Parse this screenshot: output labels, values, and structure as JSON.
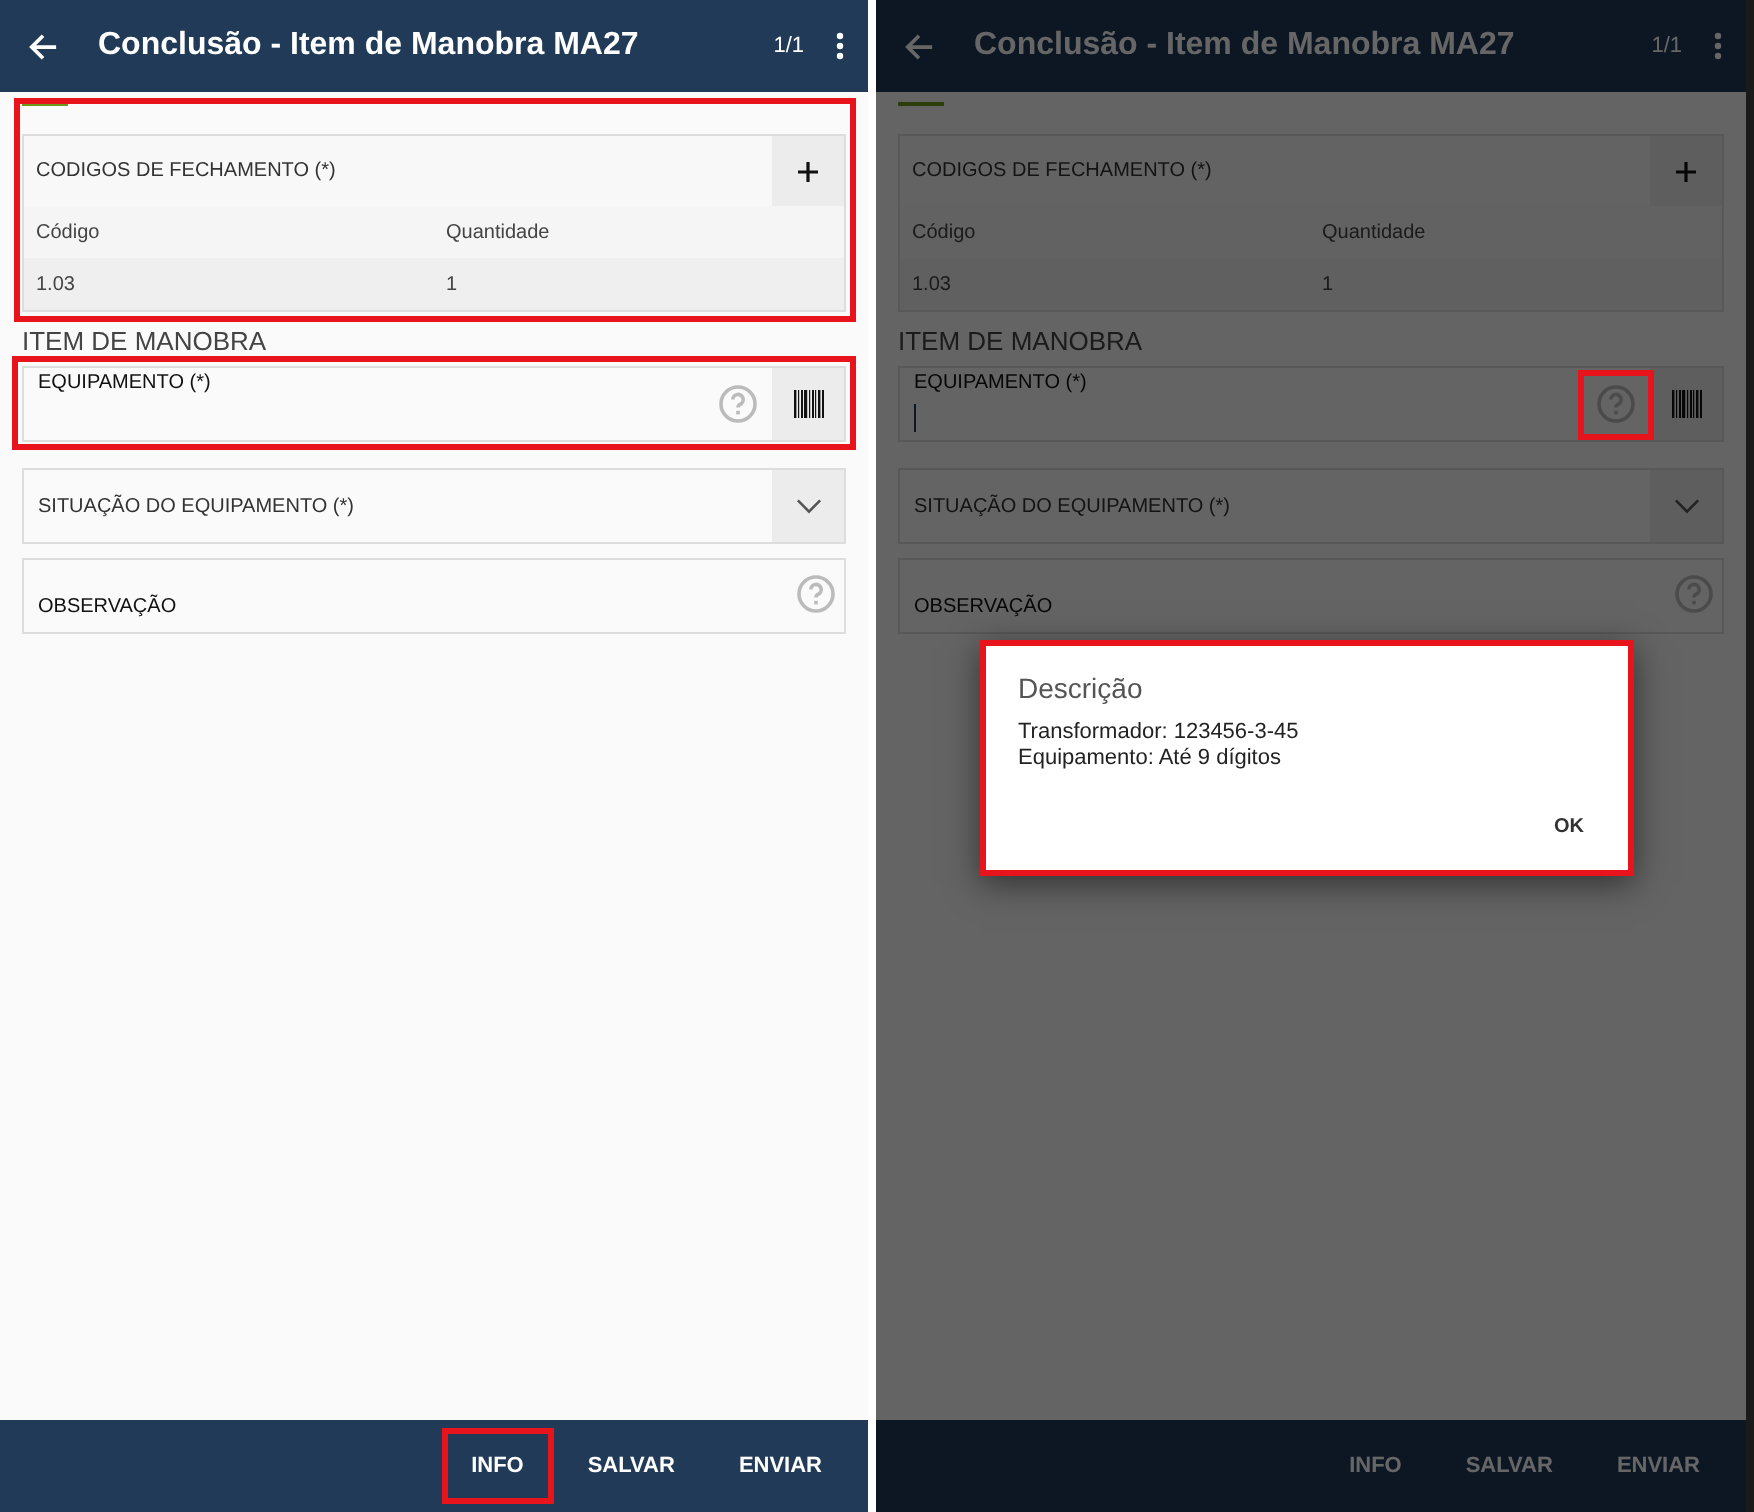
{
  "screens": [
    {
      "dimmed": false,
      "app_bar": {
        "title": "Conclusão - Item de Manobra MA27",
        "page": "1/1"
      },
      "codes_card": {
        "title": "CODIGOS DE FECHAMENTO (*)",
        "highlighted": true,
        "columns": [
          "Código",
          "Quantidade"
        ],
        "rows": [
          [
            "1.03",
            "1"
          ]
        ]
      },
      "section_title": "ITEM DE MANOBRA",
      "equipment_field": {
        "label": "EQUIPAMENTO (*)",
        "highlighted": true,
        "focused": false,
        "help_highlighted": false
      },
      "situation_select": {
        "label": "SITUAÇÃO DO EQUIPAMENTO (*)"
      },
      "observation_field": {
        "label": "OBSERVAÇÃO"
      },
      "actions": [
        {
          "label": "INFO",
          "highlighted": true
        },
        {
          "label": "SALVAR",
          "highlighted": false
        },
        {
          "label": "ENVIAR",
          "highlighted": false
        }
      ]
    },
    {
      "dimmed": true,
      "app_bar": {
        "title": "Conclusão - Item de Manobra MA27",
        "page": "1/1"
      },
      "codes_card": {
        "title": "CODIGOS DE FECHAMENTO (*)",
        "highlighted": false,
        "columns": [
          "Código",
          "Quantidade"
        ],
        "rows": [
          [
            "1.03",
            "1"
          ]
        ]
      },
      "section_title": "ITEM DE MANOBRA",
      "equipment_field": {
        "label": "EQUIPAMENTO (*)",
        "highlighted": false,
        "focused": true,
        "help_highlighted": true
      },
      "situation_select": {
        "label": "SITUAÇÃO DO EQUIPAMENTO (*)"
      },
      "observation_field": {
        "label": "OBSERVAÇÃO"
      },
      "actions": [
        {
          "label": "INFO",
          "highlighted": false
        },
        {
          "label": "SALVAR",
          "highlighted": false
        },
        {
          "label": "ENVIAR",
          "highlighted": false
        }
      ],
      "dialog": {
        "title": "Descrição",
        "lines": [
          "Transformador: 123456-3-45",
          "Equipamento: Até 9 dígitos"
        ],
        "button": "OK",
        "highlighted": true
      }
    }
  ]
}
